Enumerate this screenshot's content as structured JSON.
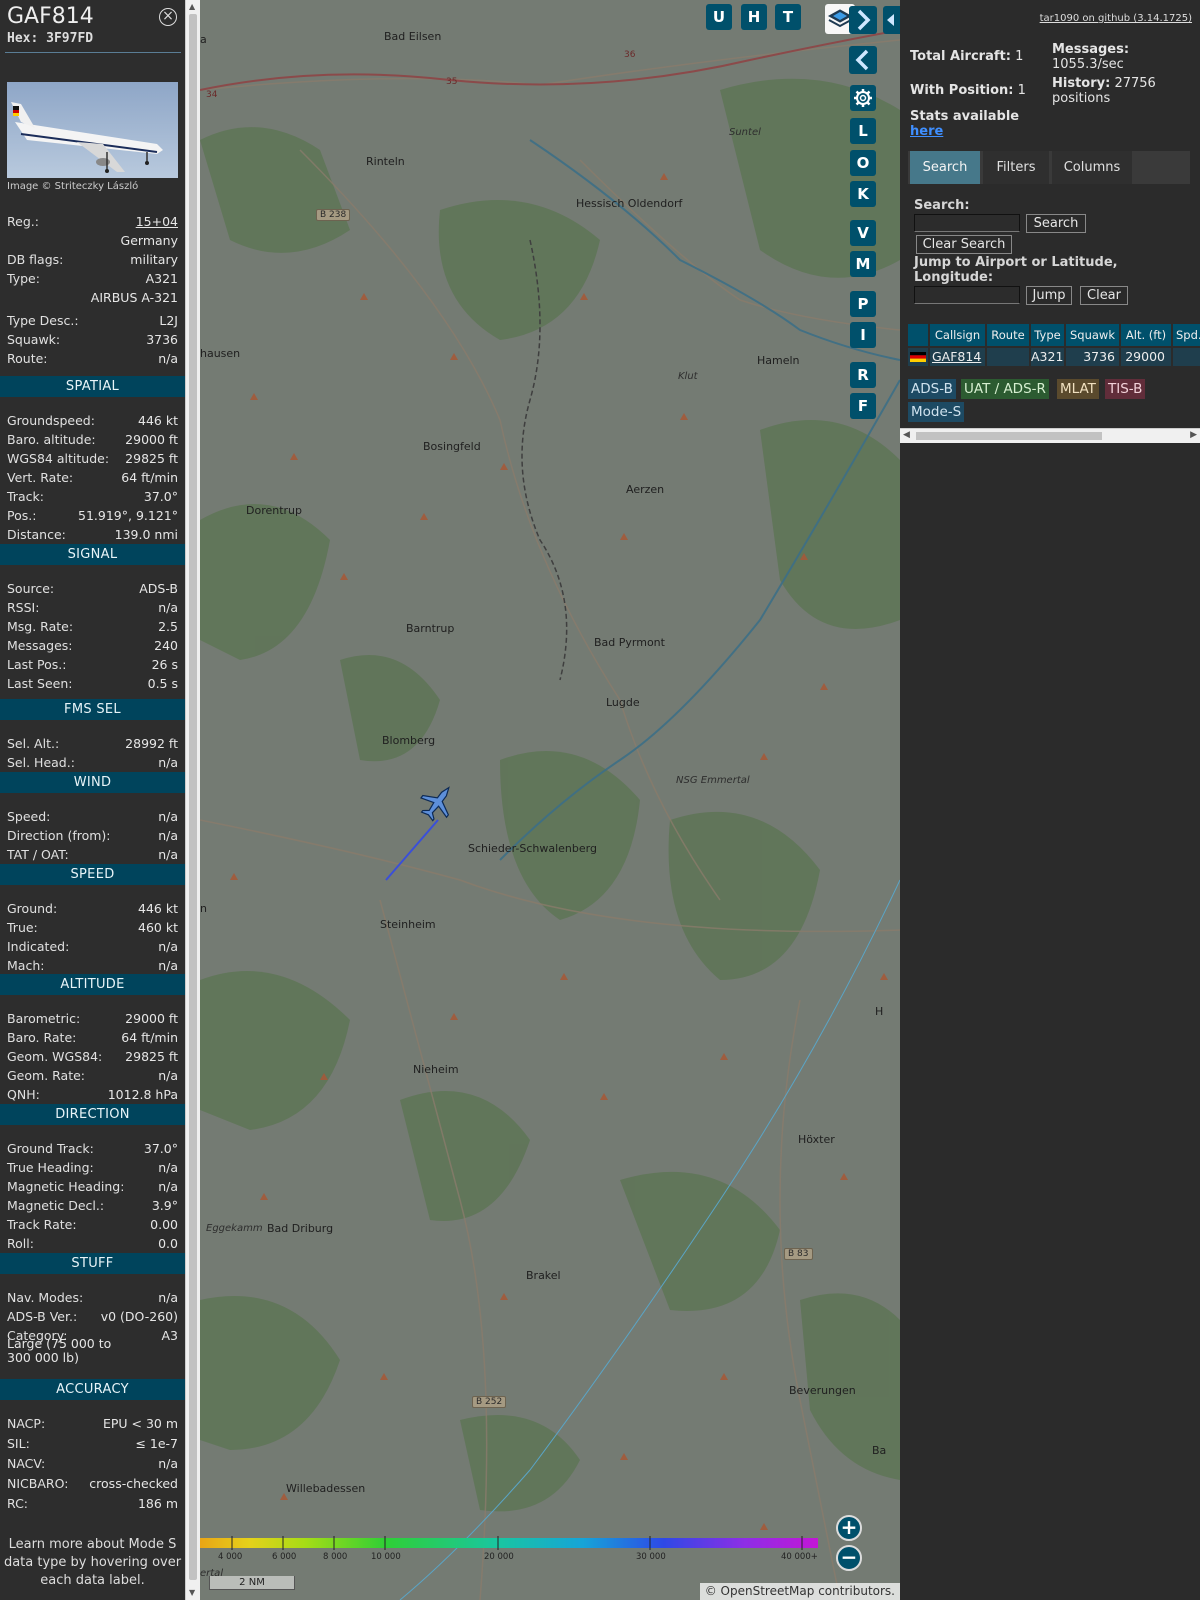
{
  "aircraft": {
    "callsign": "GAF814",
    "hex_label": "Hex: 3F97FD",
    "photo_credit": "Image © Striteczky László"
  },
  "details": {
    "reg_label": "Reg.:",
    "reg": "15+04",
    "country": "Germany",
    "dbflags_label": "DB flags:",
    "dbflags": "military",
    "type_label": "Type:",
    "type": "A321",
    "type_full": "AIRBUS A-321",
    "typedesc_label": "Type Desc.:",
    "typedesc": "L2J",
    "squawk_label": "Squawk:",
    "squawk": "3736",
    "route_label": "Route:",
    "route": "n/a"
  },
  "sections": {
    "spatial": "SPATIAL",
    "signal": "SIGNAL",
    "fms": "FMS SEL",
    "wind": "WIND",
    "speed": "SPEED",
    "altitude": "ALTITUDE",
    "direction": "DIRECTION",
    "stuff": "STUFF",
    "accuracy": "ACCURACY"
  },
  "spatial": [
    {
      "k": "Groundspeed:",
      "v": "446 kt"
    },
    {
      "k": "Baro. altitude:",
      "v": "29000 ft"
    },
    {
      "k": "WGS84 altitude:",
      "v": "29825 ft"
    },
    {
      "k": "Vert. Rate:",
      "v": "64 ft/min"
    },
    {
      "k": "Track:",
      "v": "37.0°"
    },
    {
      "k": "Pos.:",
      "v": "51.919°, 9.121°"
    },
    {
      "k": "Distance:",
      "v": "139.0 nmi"
    }
  ],
  "signal": [
    {
      "k": "Source:",
      "v": "ADS-B"
    },
    {
      "k": "RSSI:",
      "v": "n/a"
    },
    {
      "k": "Msg. Rate:",
      "v": "2.5"
    },
    {
      "k": "Messages:",
      "v": "240"
    },
    {
      "k": "Last Pos.:",
      "v": "26 s"
    },
    {
      "k": "Last Seen:",
      "v": "0.5 s"
    }
  ],
  "fms": [
    {
      "k": "Sel. Alt.:",
      "v": "28992 ft"
    },
    {
      "k": "Sel. Head.:",
      "v": "n/a"
    }
  ],
  "wind": [
    {
      "k": "Speed:",
      "v": "n/a"
    },
    {
      "k": "Direction (from):",
      "v": "n/a"
    },
    {
      "k": "TAT / OAT:",
      "v": "n/a"
    }
  ],
  "speed": [
    {
      "k": "Ground:",
      "v": "446 kt"
    },
    {
      "k": "True:",
      "v": "460 kt"
    },
    {
      "k": "Indicated:",
      "v": "n/a"
    },
    {
      "k": "Mach:",
      "v": "n/a"
    }
  ],
  "altitude": [
    {
      "k": "Barometric:",
      "v": "29000 ft"
    },
    {
      "k": "Baro. Rate:",
      "v": "64 ft/min"
    },
    {
      "k": "Geom. WGS84:",
      "v": "29825 ft"
    },
    {
      "k": "Geom. Rate:",
      "v": "n/a"
    },
    {
      "k": "QNH:",
      "v": "1012.8 hPa"
    }
  ],
  "direction": [
    {
      "k": "Ground Track:",
      "v": "37.0°"
    },
    {
      "k": "True Heading:",
      "v": "n/a"
    },
    {
      "k": "Magnetic Heading:",
      "v": "n/a"
    },
    {
      "k": "Magnetic Decl.:",
      "v": "3.9°"
    },
    {
      "k": "Track Rate:",
      "v": "0.00"
    },
    {
      "k": "Roll:",
      "v": "0.0"
    }
  ],
  "stuff": [
    {
      "k": "Nav. Modes:",
      "v": "n/a"
    },
    {
      "k": "ADS-B Ver.:",
      "v": "v0 (DO-260)"
    },
    {
      "k": "Category:",
      "v": "A3"
    }
  ],
  "stuff_category_desc": "Large (75 000 to 300 000 lb)",
  "accuracy": [
    {
      "k": "NACP:",
      "v": "EPU < 30 m"
    },
    {
      "k": "SIL:",
      "v": "≤ 1e-7"
    },
    {
      "k": "NACV:",
      "v": "n/a"
    },
    {
      "k": "NICBARO:",
      "v": "cross-checked"
    },
    {
      "k": "RC:",
      "v": "186 m"
    }
  ],
  "learn_more": "Learn more about Mode S data type by hovering over each data label.",
  "map": {
    "top_buttons": [
      "U",
      "H",
      "T"
    ],
    "side_buttons": [
      "L",
      "O",
      "K",
      "V",
      "M",
      "P",
      "I",
      "R",
      "F"
    ],
    "places": [
      "Bad Eilsen",
      "Rinteln",
      "Hessisch Oldendorf",
      "Suntel",
      "Hameln",
      "hausen",
      "Klut",
      "Bosingfeld",
      "Aerzen",
      "Dorentrup",
      "Barntrup",
      "Bad Pyrmont",
      "Lugde",
      "Blomberg",
      "NSG Emmertal",
      "Schieder-Schwalenberg",
      "Steinheim",
      "Nieheim",
      "Höxter",
      "Eggekamm",
      "Bad Driburg",
      "Brakel",
      "Beverungen",
      "Willebadessen",
      "a",
      "n",
      "H",
      "Ba",
      "ertal"
    ],
    "roads": [
      "B 238",
      "B 83",
      "B 252",
      "35",
      "36",
      "34"
    ],
    "alt_labels": [
      "4 000",
      "6 000",
      "8 000",
      "10 000",
      "20 000",
      "30 000",
      "40 000+"
    ],
    "scale": "2 NM",
    "attribution_prefix": "© ",
    "attribution_link": "OpenStreetMap",
    "attribution_suffix": " contributors."
  },
  "panel": {
    "github": "tar1090 on github (3.14.1725)",
    "total_aircraft_label": "Total Aircraft:",
    "total_aircraft": "1",
    "with_position_label": "With Position:",
    "with_position": "1",
    "messages_label": "Messages:",
    "messages_rate": "1055.3/sec",
    "history_label": "History:",
    "history_count": "27756",
    "history_unit": "positions",
    "stats_text": "Stats available",
    "stats_link": "here",
    "tabs": [
      "Search",
      "Filters",
      "Columns"
    ],
    "search_label": "Search:",
    "search_button": "Search",
    "clear_search_button": "Clear Search",
    "jump_label": "Jump to Airport or Latitude, Longitude:",
    "jump_button": "Jump",
    "clear_button": "Clear",
    "table_headers": [
      "Callsign",
      "Route",
      "Type",
      "Squawk",
      "Alt. (ft)",
      "Spd."
    ],
    "table_row": {
      "callsign": "GAF814",
      "route": "",
      "type": "A321",
      "squawk": "3736",
      "alt": "29000",
      "spd": ""
    },
    "badges": [
      {
        "label": "ADS-B",
        "color": "#1d4a63"
      },
      {
        "label": "UAT / ADS-R",
        "color": "#2c5b31"
      },
      {
        "label": "MLAT",
        "color": "#5a4a2d"
      },
      {
        "label": "TIS-B",
        "color": "#612d3a"
      },
      {
        "label": "Mode-S",
        "color": "#1d4a63"
      }
    ]
  },
  "colors": {
    "accent": "#00506b",
    "section": "#00445c",
    "track": "#3a4fd9"
  }
}
